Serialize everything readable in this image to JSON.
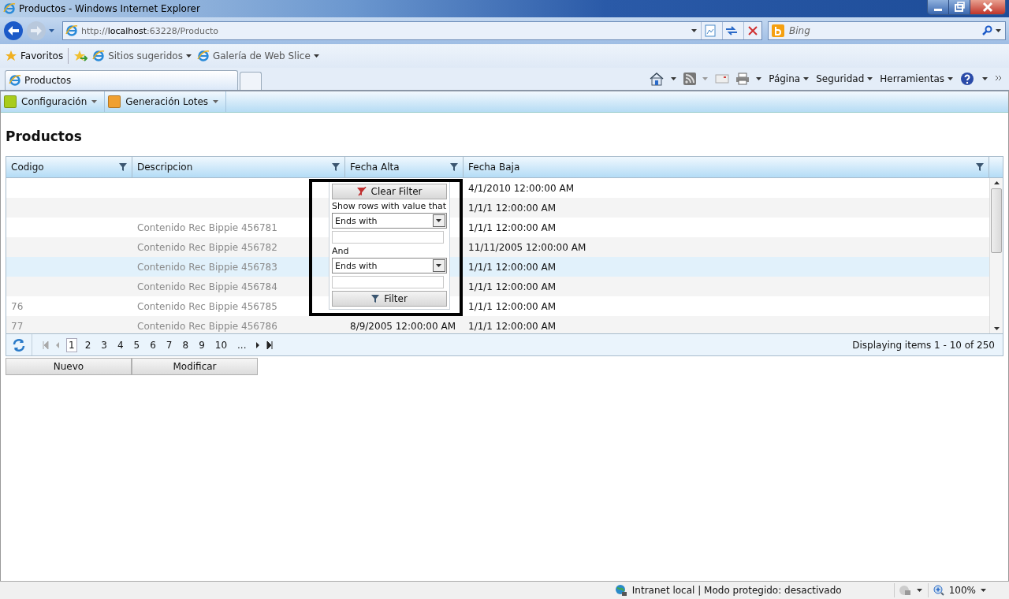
{
  "window": {
    "title": "Productos - Windows Internet Explorer"
  },
  "address_bar": {
    "url_prefix": "http://",
    "url_host": "localhost",
    "url_rest": ":63228/Producto"
  },
  "search": {
    "placeholder": "Bing"
  },
  "favorites_bar": {
    "favorites": "Favoritos",
    "items": [
      "Sitios sugeridos",
      "Galería de Web Slice"
    ]
  },
  "tabs": [
    {
      "label": "Productos",
      "selected": true
    }
  ],
  "command_bar": [
    "Página",
    "Seguridad",
    "Herramientas"
  ],
  "app_menu": [
    {
      "label": "Configuración",
      "color": "#a8cc1c"
    },
    {
      "label": "Generación Lotes",
      "color": "#f0a030"
    }
  ],
  "page_title": "Productos",
  "grid": {
    "columns": [
      "Codigo",
      "Descripcion",
      "Fecha Alta",
      "Fecha Baja"
    ],
    "rows": [
      {
        "codigo": "",
        "descripcion": "",
        "fecha_alta": "",
        "fecha_baja": "4/1/2010 12:00:00 AM",
        "selected": false
      },
      {
        "codigo": "",
        "descripcion": "",
        "fecha_alta": "",
        "fecha_baja": "1/1/1 12:00:00 AM",
        "selected": false
      },
      {
        "codigo": "",
        "descripcion": "Contenido Rec Bippie 456781",
        "fecha_alta": "",
        "fecha_baja": "1/1/1 12:00:00 AM",
        "selected": false
      },
      {
        "codigo": "",
        "descripcion": "Contenido Rec Bippie 456782",
        "fecha_alta": "",
        "fecha_baja": "11/11/2005 12:00:00 AM",
        "selected": false
      },
      {
        "codigo": "",
        "descripcion": "Contenido Rec Bippie 456783",
        "fecha_alta": "",
        "fecha_baja": "1/1/1 12:00:00 AM",
        "selected": true
      },
      {
        "codigo": "",
        "descripcion": "Contenido Rec Bippie 456784",
        "fecha_alta": "",
        "fecha_baja": "1/1/1 12:00:00 AM",
        "selected": false
      },
      {
        "codigo": "76",
        "descripcion": "Contenido Rec Bippie 456785",
        "fecha_alta": "",
        "fecha_baja": "1/1/1 12:00:00 AM",
        "selected": false
      },
      {
        "codigo": "77",
        "descripcion": "Contenido Rec Bippie 456786",
        "fecha_alta": "8/9/2005 12:00:00 AM",
        "fecha_baja": "1/1/1 12:00:00 AM",
        "selected": false
      }
    ],
    "pager": {
      "pages": [
        {
          "label": "1",
          "selected": true
        },
        {
          "label": "2",
          "selected": false
        },
        {
          "label": "3",
          "selected": false
        },
        {
          "label": "4",
          "selected": false
        },
        {
          "label": "5",
          "selected": false
        },
        {
          "label": "6",
          "selected": false
        },
        {
          "label": "7",
          "selected": false
        },
        {
          "label": "8",
          "selected": false
        },
        {
          "label": "9",
          "selected": false
        },
        {
          "label": "10",
          "selected": false
        },
        {
          "label": "...",
          "selected": false
        }
      ],
      "info": "Displaying items 1 - 10 of 250"
    }
  },
  "filter_menu": {
    "clear": "Clear Filter",
    "prompt": "Show rows with value that",
    "operator_1": "Ends with",
    "conjunction": "And",
    "operator_2": "Ends with",
    "filter": "Filter"
  },
  "buttons": [
    "Nuevo",
    "Modificar"
  ],
  "status_bar": {
    "zone": "Intranet local | Modo protegido: desactivado",
    "zoom": "100%"
  }
}
